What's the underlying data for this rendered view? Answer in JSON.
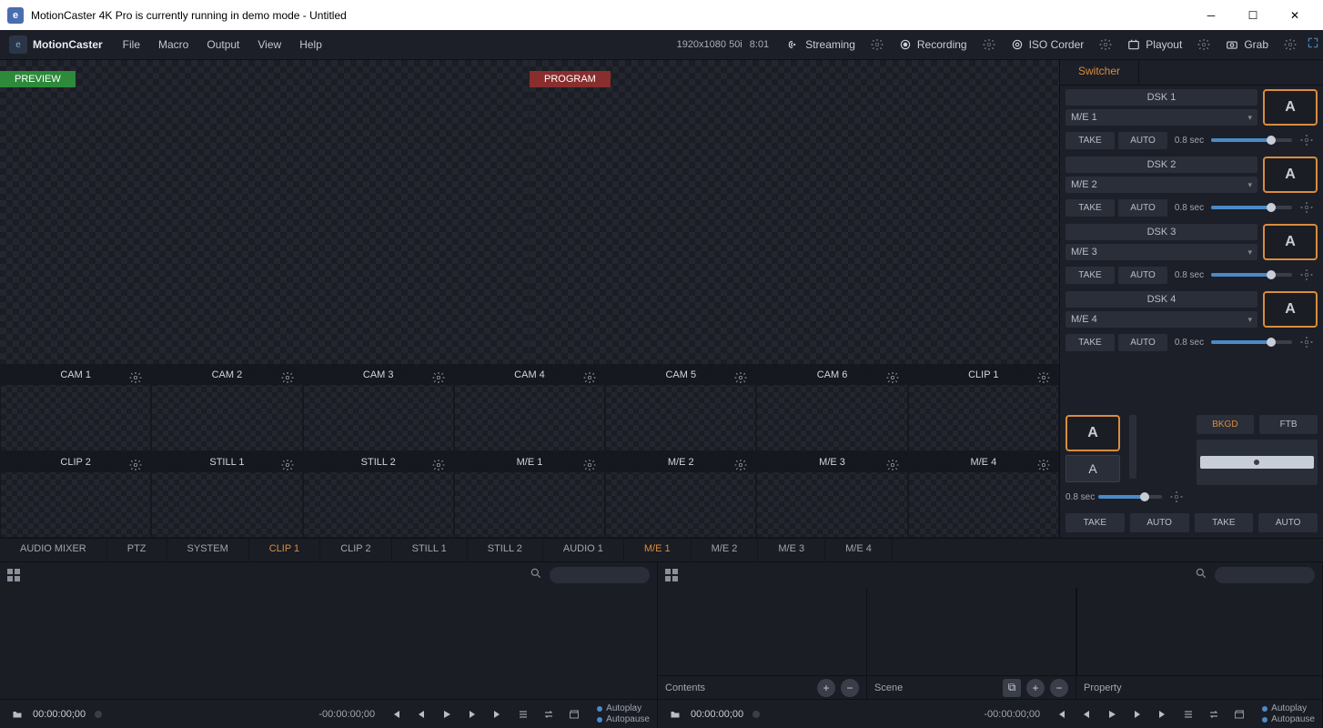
{
  "window": {
    "title": "MotionCaster 4K Pro is currently running in demo mode - Untitled"
  },
  "brand": "MotionCaster",
  "menu": {
    "file": "File",
    "macro": "Macro",
    "output": "Output",
    "view": "View",
    "help": "Help"
  },
  "status": {
    "resolution": "1920x1080 50i",
    "time": "8:01"
  },
  "toolbar": {
    "streaming": "Streaming",
    "recording": "Recording",
    "isocorder": "ISO Corder",
    "playout": "Playout",
    "grab": "Grab"
  },
  "preview_label": "PREVIEW",
  "program_label": "PROGRAM",
  "sources": {
    "row1": [
      "CAM 1",
      "CAM 2",
      "CAM 3",
      "CAM 4",
      "CAM 5",
      "CAM 6",
      "CLIP 1"
    ],
    "row2": [
      "CLIP 2",
      "STILL 1",
      "STILL 2",
      "M/E 1",
      "M/E 2",
      "M/E 3",
      "M/E 4"
    ]
  },
  "switcher_tab": "Switcher",
  "dsk": [
    {
      "title": "DSK 1",
      "sel": "M/E 1",
      "thumb": "A",
      "take": "TAKE",
      "auto": "AUTO",
      "dur": "0.8 sec"
    },
    {
      "title": "DSK 2",
      "sel": "M/E 2",
      "thumb": "A",
      "take": "TAKE",
      "auto": "AUTO",
      "dur": "0.8 sec"
    },
    {
      "title": "DSK 3",
      "sel": "M/E 3",
      "thumb": "A",
      "take": "TAKE",
      "auto": "AUTO",
      "dur": "0.8 sec"
    },
    {
      "title": "DSK 4",
      "sel": "M/E 4",
      "thumb": "A",
      "take": "TAKE",
      "auto": "AUTO",
      "dur": "0.8 sec"
    }
  ],
  "mix": {
    "thumbA": "A",
    "thumbB": "A",
    "dur": "0.8 sec",
    "bkgd": "BKGD",
    "ftb": "FTB",
    "take1": "TAKE",
    "auto1": "AUTO",
    "take2": "TAKE",
    "auto2": "AUTO"
  },
  "tabs": [
    "AUDIO MIXER",
    "PTZ",
    "SYSTEM",
    "CLIP 1",
    "CLIP 2",
    "STILL 1",
    "STILL 2",
    "AUDIO 1",
    "M/E 1",
    "M/E 2",
    "M/E 3",
    "M/E 4"
  ],
  "tabs_active": [
    3,
    8
  ],
  "panel": {
    "contents": "Contents",
    "scene": "Scene",
    "property": "Property",
    "tc": "00:00:00;00",
    "tc_neg": "-00:00:00;00",
    "autoplay": "Autoplay",
    "autopause": "Autopause"
  }
}
